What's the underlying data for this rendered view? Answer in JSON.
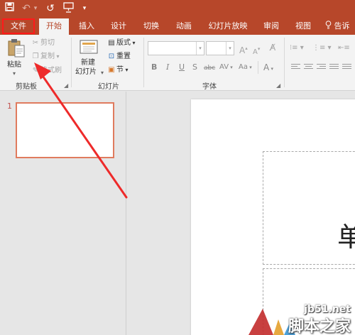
{
  "quick_access": {
    "save_icon": "save-icon",
    "undo_icon": "undo-icon",
    "redo_icon": "redo-icon",
    "present_icon": "present-from-start-icon",
    "customize_icon": "customize-qat-icon"
  },
  "tabs": [
    "文件",
    "开始",
    "插入",
    "设计",
    "切换",
    "动画",
    "幻灯片放映",
    "审阅",
    "视图"
  ],
  "active_tab": "开始",
  "tell_me": "告诉",
  "ribbon": {
    "clipboard": {
      "paste": "粘贴",
      "cut": "剪切",
      "copy": "复制",
      "format_painter": "格式刷",
      "group_label": "剪贴板"
    },
    "slides": {
      "new_slide_line1": "新建",
      "new_slide_line2": "幻灯片",
      "layout": "版式",
      "reset": "重置",
      "section": "节",
      "group_label": "幻灯片"
    },
    "font": {
      "bold": "B",
      "italic": "I",
      "underline": "U",
      "shadow": "S",
      "strikethrough": "abc",
      "spacing": "AV",
      "change_case": "Aa",
      "font_color": "A",
      "grow": "A",
      "shrink": "A",
      "group_label": "字体"
    }
  },
  "slide_panel": {
    "slide_number": "1"
  },
  "editor": {
    "title_char": "单"
  },
  "watermark": {
    "site": "jb51.net",
    "name": "脚本之家"
  },
  "colors": {
    "accent": "#b7472a",
    "annotation": "#ee2a2a",
    "thumb_border": "#e07b5e"
  }
}
